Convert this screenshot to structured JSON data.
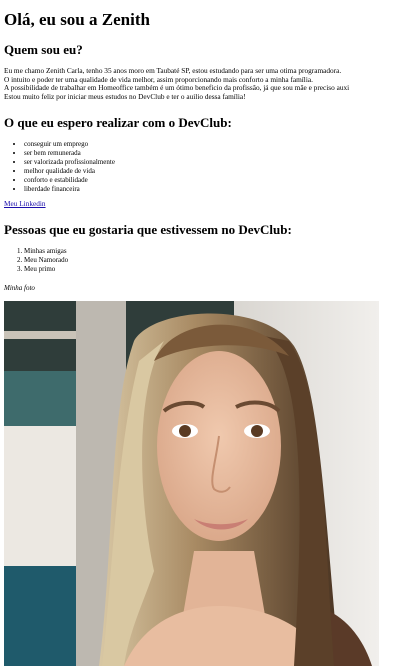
{
  "title": "Olá, eu sou a Zenith",
  "about": {
    "heading": "Quem sou eu?",
    "lines": [
      "Eu me chamo Zenith Carla, tenho 35 anos moro em Taubaté SP, estou estudando para ser uma otima programadora.",
      "O intuito e poder ter uma qualidade de vida melhor, assim proporcionando mais conforto a minha família.",
      "A possibilidade de trabalhar em Homeoffice também é um ótimo beneficio da profissão, já que sou mãe e preciso auxi",
      "Estou muito feliz por iniciar meus estudos no DevClub e ter o auilio dessa família!"
    ]
  },
  "goals": {
    "heading": "O que eu espero realizar com o DevClub:",
    "items": [
      "conseguir um emprego",
      "ser bem remunerada",
      "ser valorizada profissionalmente",
      "melhor qualidade de vida",
      "conforto e estabilidade",
      "liberdade financeira"
    ]
  },
  "link": {
    "label": "Meu Linkedin"
  },
  "people": {
    "heading": "Pessoas que eu gostaria que estivessem no DevClub:",
    "items": [
      "Minhas amigas",
      "Meu Namorado",
      "Meu primo"
    ]
  },
  "photo": {
    "caption": "Minha foto"
  },
  "colors": {
    "link": "#1a0dab",
    "text": "#000000",
    "background": "#ffffff"
  }
}
